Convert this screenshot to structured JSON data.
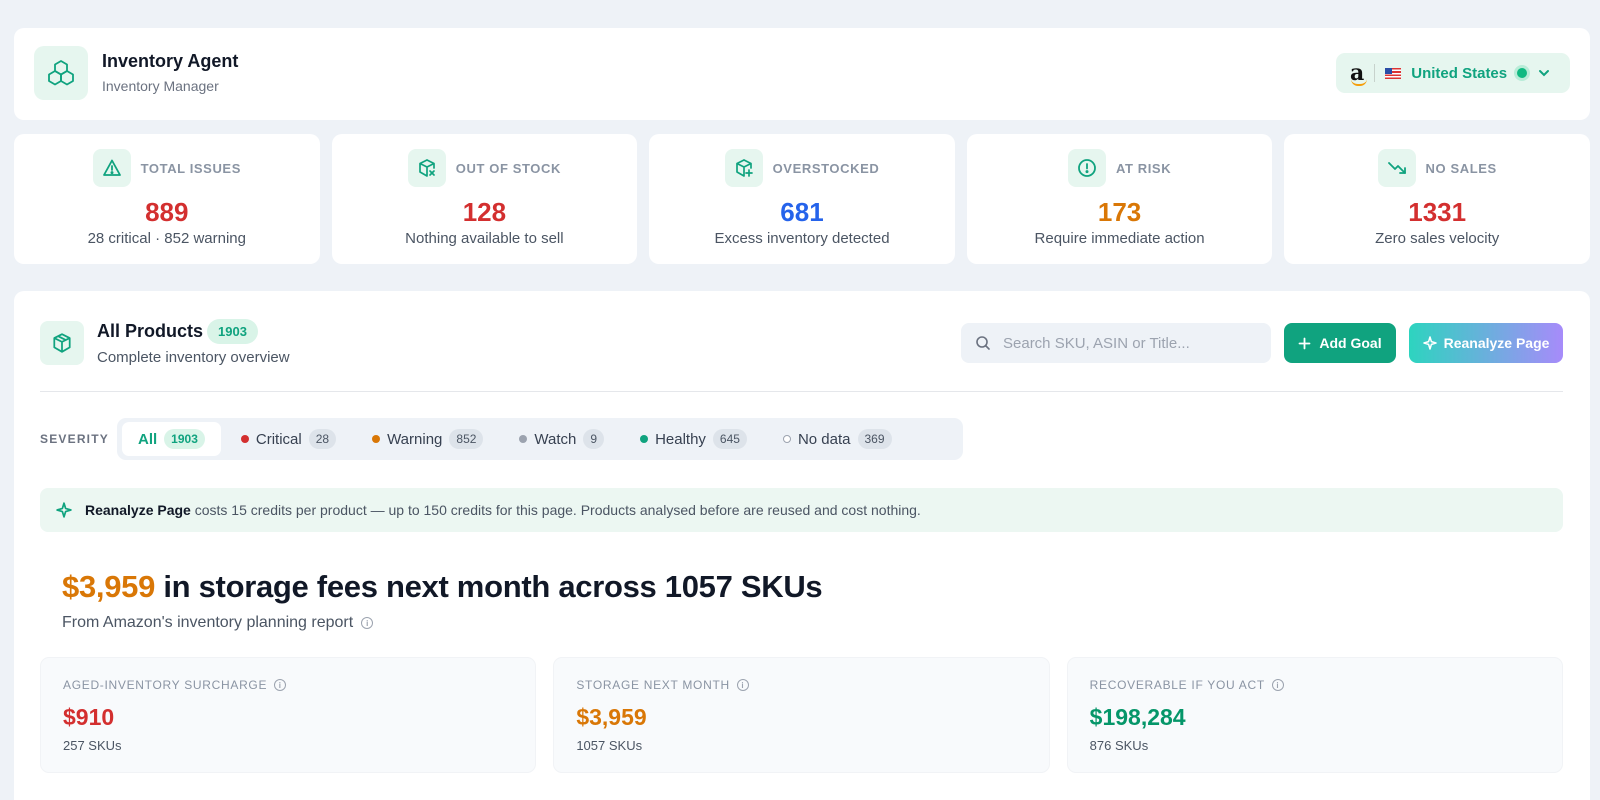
{
  "app": {
    "title": "Inventory Agent",
    "subtitle": "Inventory Manager"
  },
  "marketplace": {
    "label": "United States",
    "brand_icon": "amazon-icon",
    "flag_icon": "us-flag-icon"
  },
  "stats": [
    {
      "label": "TOTAL ISSUES",
      "value": "889",
      "sub": "28 critical · 852 warning",
      "color": "#d32f2f",
      "icon": "warning-icon"
    },
    {
      "label": "OUT OF STOCK",
      "value": "128",
      "sub": "Nothing available to sell",
      "color": "#d32f2f",
      "icon": "box-x-icon"
    },
    {
      "label": "OVERSTOCKED",
      "value": "681",
      "sub": "Excess inventory detected",
      "color": "#2563eb",
      "icon": "box-plus-icon"
    },
    {
      "label": "AT RISK",
      "value": "173",
      "sub": "Require immediate action",
      "color": "#d97706",
      "icon": "alert-circle-icon"
    },
    {
      "label": "NO SALES",
      "value": "1331",
      "sub": "Zero sales velocity",
      "color": "#d32f2f",
      "icon": "trend-down-icon"
    }
  ],
  "products": {
    "title": "All Products",
    "count": "1903",
    "subtitle": "Complete inventory overview",
    "search_placeholder": "Search SKU, ASIN or Title...",
    "add_goal_label": "Add Goal",
    "reanalyze_label": "Reanalyze Page"
  },
  "severity": {
    "label": "SEVERITY",
    "chips": [
      {
        "label": "All",
        "count": "1903",
        "dot": null
      },
      {
        "label": "Critical",
        "count": "28",
        "dot": "#d32f2f"
      },
      {
        "label": "Warning",
        "count": "852",
        "dot": "#d97706"
      },
      {
        "label": "Watch",
        "count": "9",
        "dot": "#9ca3af"
      },
      {
        "label": "Healthy",
        "count": "645",
        "dot": "#10a37f"
      },
      {
        "label": "No data",
        "count": "369",
        "dot": "hollow"
      }
    ]
  },
  "banner": {
    "strong": "Reanalyze Page",
    "text": " costs 15 credits per product — up to 150 credits for this page. Products analysed before are reused and cost nothing."
  },
  "storage": {
    "amount": "$3,959",
    "headline_rest": " in storage fees next month across 1057 SKUs",
    "source": "From Amazon's inventory planning report"
  },
  "cards": [
    {
      "label": "AGED-INVENTORY SURCHARGE",
      "value": "$910",
      "sub": "257 SKUs",
      "color": "#d32f2f"
    },
    {
      "label": "STORAGE NEXT MONTH",
      "value": "$3,959",
      "sub": "1057 SKUs",
      "color": "#d97706"
    },
    {
      "label": "RECOVERABLE IF YOU ACT",
      "value": "$198,284",
      "sub": "876 SKUs",
      "color": "#059669"
    }
  ]
}
